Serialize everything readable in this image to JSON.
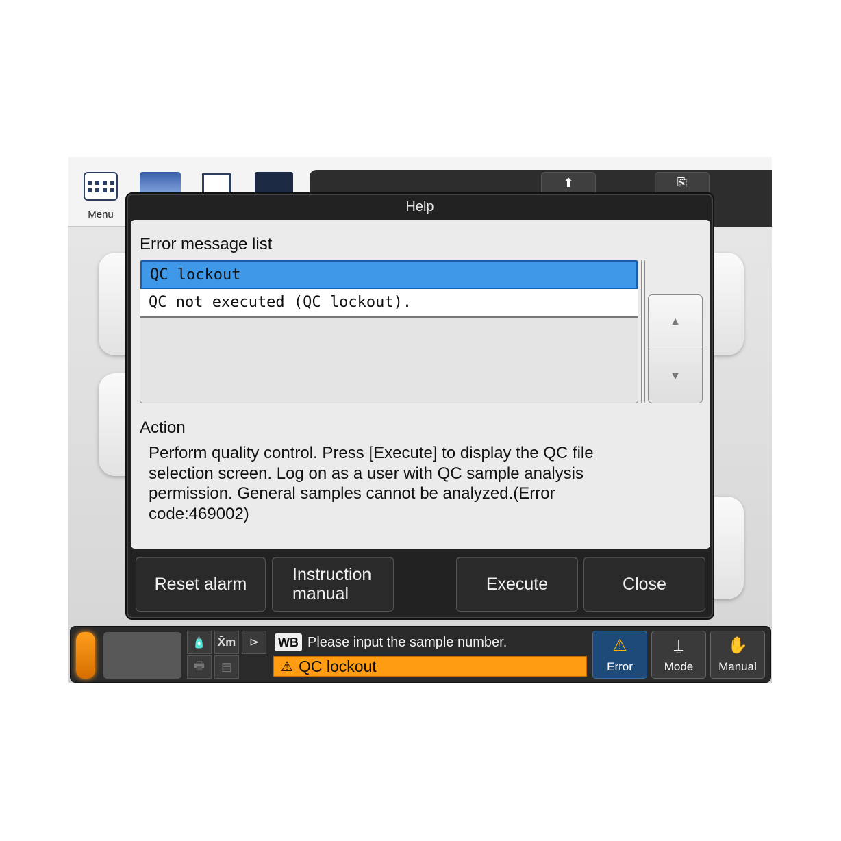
{
  "toolbar": {
    "menu_label": "Menu"
  },
  "dialog": {
    "title": "Help",
    "error_list_heading": "Error message list",
    "errors": [
      {
        "text": "QC lockout",
        "selected": true
      },
      {
        "text": "QC not executed (QC lockout).",
        "selected": false
      }
    ],
    "action_heading": "Action",
    "action_text": "Perform quality control. Press [Execute] to display the QC file selection screen. Log on as a user with QC sample analysis permission. General samples cannot be analyzed.(Error code:469002)",
    "buttons": {
      "reset_alarm": "Reset alarm",
      "instruction_manual_line1": "Instruction",
      "instruction_manual_line2": "manual",
      "execute": "Execute",
      "close": "Close"
    }
  },
  "statusbar": {
    "mode_tag": "WB",
    "prompt": "Please input the sample number.",
    "alarm": "QC lockout",
    "xbar_label": "X̄m",
    "buttons": {
      "error": "Error",
      "mode": "Mode",
      "manual": "Manual"
    }
  },
  "colors": {
    "selected_row": "#3f99e8",
    "alarm": "#ff9c11",
    "dialog_frame": "#222222",
    "error_button": "#1e4a7a"
  },
  "icons": [
    "menu-grid-icon",
    "warning-icon",
    "tubes-icon",
    "manual-hand-icon",
    "arrow-up-icon",
    "arrow-down-icon",
    "reagent-bottle-icon",
    "printer-icon"
  ]
}
